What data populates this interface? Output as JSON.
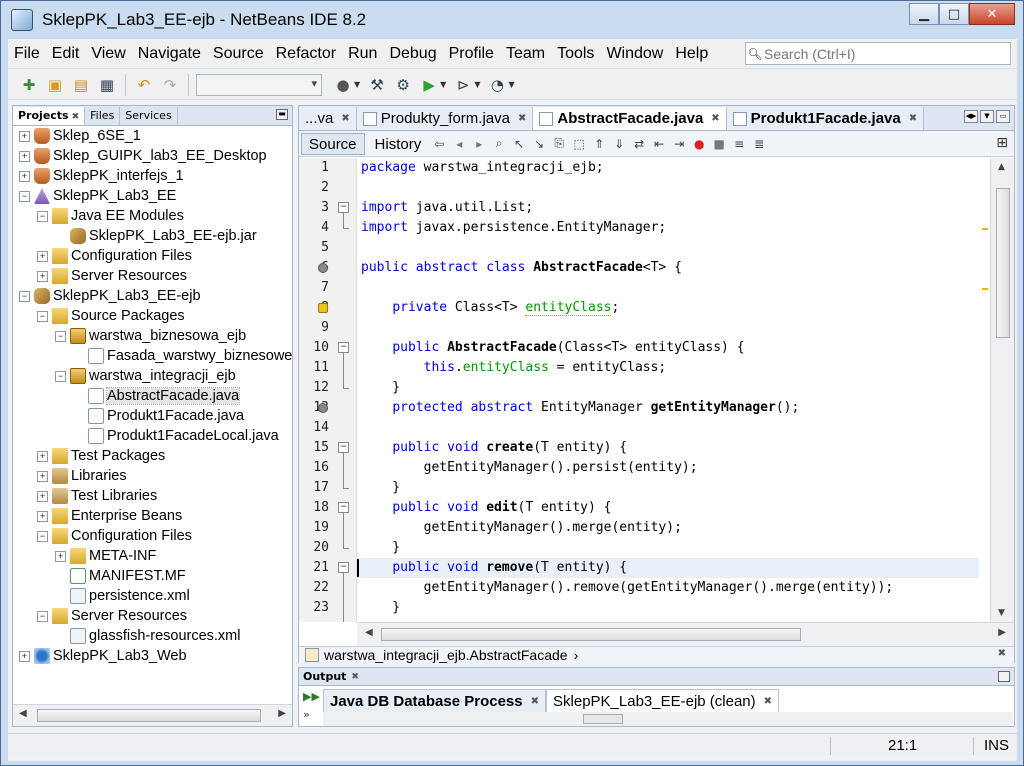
{
  "window": {
    "title": "SklepPK_Lab3_EE-ejb - NetBeans IDE 8.2"
  },
  "menu": [
    "File",
    "Edit",
    "View",
    "Navigate",
    "Source",
    "Refactor",
    "Run",
    "Debug",
    "Profile",
    "Team",
    "Tools",
    "Window",
    "Help"
  ],
  "search": {
    "placeholder": "Search (Ctrl+I)"
  },
  "toolbar": {
    "config_value": ""
  },
  "left_tabs": [
    "Projects",
    "Files",
    "Services"
  ],
  "tree": [
    {
      "label": "Sklep_6SE_1",
      "depth": 0,
      "tog": "+",
      "icon": "cup"
    },
    {
      "label": "Sklep_GUIPK_lab3_EE_Desktop",
      "depth": 0,
      "tog": "+",
      "icon": "cup"
    },
    {
      "label": "SklepPK_interfejs_1",
      "depth": 0,
      "tog": "+",
      "icon": "cup"
    },
    {
      "label": "SklepPK_Lab3_EE",
      "depth": 0,
      "tog": "−",
      "icon": "proj-ent"
    },
    {
      "label": "Java EE Modules",
      "depth": 1,
      "tog": "−",
      "icon": "folder"
    },
    {
      "label": "SklepPK_Lab3_EE-ejb.jar",
      "depth": 2,
      "tog": "",
      "icon": "proj-jar"
    },
    {
      "label": "Configuration Files",
      "depth": 1,
      "tog": "+",
      "icon": "folder"
    },
    {
      "label": "Server Resources",
      "depth": 1,
      "tog": "+",
      "icon": "folder"
    },
    {
      "label": "SklepPK_Lab3_EE-ejb",
      "depth": 0,
      "tog": "−",
      "icon": "proj-jar"
    },
    {
      "label": "Source Packages",
      "depth": 1,
      "tog": "−",
      "icon": "folder"
    },
    {
      "label": "warstwa_biznesowa_ejb",
      "depth": 2,
      "tog": "−",
      "icon": "pkg"
    },
    {
      "label": "Fasada_warstwy_biznesowej",
      "depth": 3,
      "tog": "",
      "icon": "java"
    },
    {
      "label": "warstwa_integracji_ejb",
      "depth": 2,
      "tog": "−",
      "icon": "pkg"
    },
    {
      "label": "AbstractFacade.java",
      "depth": 3,
      "tog": "",
      "icon": "java",
      "selected": true
    },
    {
      "label": "Produkt1Facade.java",
      "depth": 3,
      "tog": "",
      "icon": "java"
    },
    {
      "label": "Produkt1FacadeLocal.java",
      "depth": 3,
      "tog": "",
      "icon": "java"
    },
    {
      "label": "Test Packages",
      "depth": 1,
      "tog": "+",
      "icon": "folder"
    },
    {
      "label": "Libraries",
      "depth": 1,
      "tog": "+",
      "icon": "lib"
    },
    {
      "label": "Test Libraries",
      "depth": 1,
      "tog": "+",
      "icon": "lib"
    },
    {
      "label": "Enterprise Beans",
      "depth": 1,
      "tog": "+",
      "icon": "folder"
    },
    {
      "label": "Configuration Files",
      "depth": 1,
      "tog": "−",
      "icon": "folder"
    },
    {
      "label": "META-INF",
      "depth": 2,
      "tog": "+",
      "icon": "folder"
    },
    {
      "label": "MANIFEST.MF",
      "depth": 2,
      "tog": "",
      "icon": "mf"
    },
    {
      "label": "persistence.xml",
      "depth": 2,
      "tog": "",
      "icon": "xml"
    },
    {
      "label": "Server Resources",
      "depth": 1,
      "tog": "−",
      "icon": "folder"
    },
    {
      "label": "glassfish-resources.xml",
      "depth": 2,
      "tog": "",
      "icon": "xml"
    },
    {
      "label": "SklepPK_Lab3_Web",
      "depth": 0,
      "tog": "+",
      "icon": "proj-web"
    }
  ],
  "editor_tabs": [
    {
      "label": "...va",
      "active": false
    },
    {
      "label": "Produkty_form.java",
      "active": false
    },
    {
      "label": "AbstractFacade.java",
      "active": true
    },
    {
      "label": "Produkt1Facade.java",
      "active": false,
      "bold": true
    }
  ],
  "editor_subtabs": {
    "source": "Source",
    "history": "History"
  },
  "code_lines": [
    {
      "n": "1",
      "html": "<span class=\"kw\">package</span> warstwa_integracji_ejb;"
    },
    {
      "n": "2",
      "html": ""
    },
    {
      "n": "3",
      "html": "<span class=\"kw\">import</span> java.util.List;",
      "fold": "start"
    },
    {
      "n": "4",
      "html": "<span class=\"kw\">import</span> javax.persistence.EntityManager;",
      "fold": "end"
    },
    {
      "n": "5",
      "html": ""
    },
    {
      "n": "6",
      "html": "<span class=\"kw\">public abstract class</span> <span class=\"fn\">AbstractFacade</span>&lt;T&gt; {",
      "mark": "dot"
    },
    {
      "n": "7",
      "html": ""
    },
    {
      "n": "8",
      "html": "    <span class=\"kw\">private</span> Class&lt;T&gt; <span class=\"fld warnu\">entityClass</span>;",
      "mark": "warn"
    },
    {
      "n": "9",
      "html": ""
    },
    {
      "n": "10",
      "html": "    <span class=\"kw\">public</span> <span class=\"fn\">AbstractFacade</span>(Class&lt;T&gt; entityClass) {",
      "fold": "start"
    },
    {
      "n": "11",
      "html": "        <span class=\"kw\">this</span>.<span class=\"fld\">entityClass</span> = entityClass;"
    },
    {
      "n": "12",
      "html": "    }",
      "fold": "end"
    },
    {
      "n": "13",
      "html": "    <span class=\"kw\">protected abstract</span> EntityManager <span class=\"fn\">getEntityManager</span>();",
      "mark": "dot"
    },
    {
      "n": "14",
      "html": ""
    },
    {
      "n": "15",
      "html": "    <span class=\"kw\">public void</span> <span class=\"fn\">create</span>(T entity) {",
      "fold": "start"
    },
    {
      "n": "16",
      "html": "        getEntityManager().persist(entity);"
    },
    {
      "n": "17",
      "html": "    }",
      "fold": "end"
    },
    {
      "n": "18",
      "html": "    <span class=\"kw\">public void</span> <span class=\"fn\">edit</span>(T entity) {",
      "fold": "start"
    },
    {
      "n": "19",
      "html": "        getEntityManager().merge(entity);"
    },
    {
      "n": "20",
      "html": "    }",
      "fold": "end"
    },
    {
      "n": "21",
      "html": "    <span class=\"kw\">public void</span> <span class=\"fn\">remove</span>(T entity) {",
      "fold": "start",
      "current": true
    },
    {
      "n": "22",
      "html": "        getEntityManager().remove(getEntityManager().merge(entity));"
    },
    {
      "n": "23",
      "html": "    }"
    }
  ],
  "breadcrumb": "warstwa_integracji_ejb.AbstractFacade",
  "output": {
    "title": "Output",
    "tabs": [
      {
        "label": "Java DB Database Process",
        "bold": true,
        "active": false
      },
      {
        "label": "SklepPK_Lab3_EE-ejb (clean)",
        "bold": false,
        "active": true
      }
    ]
  },
  "status": {
    "position": "21:1",
    "mode": "INS"
  }
}
